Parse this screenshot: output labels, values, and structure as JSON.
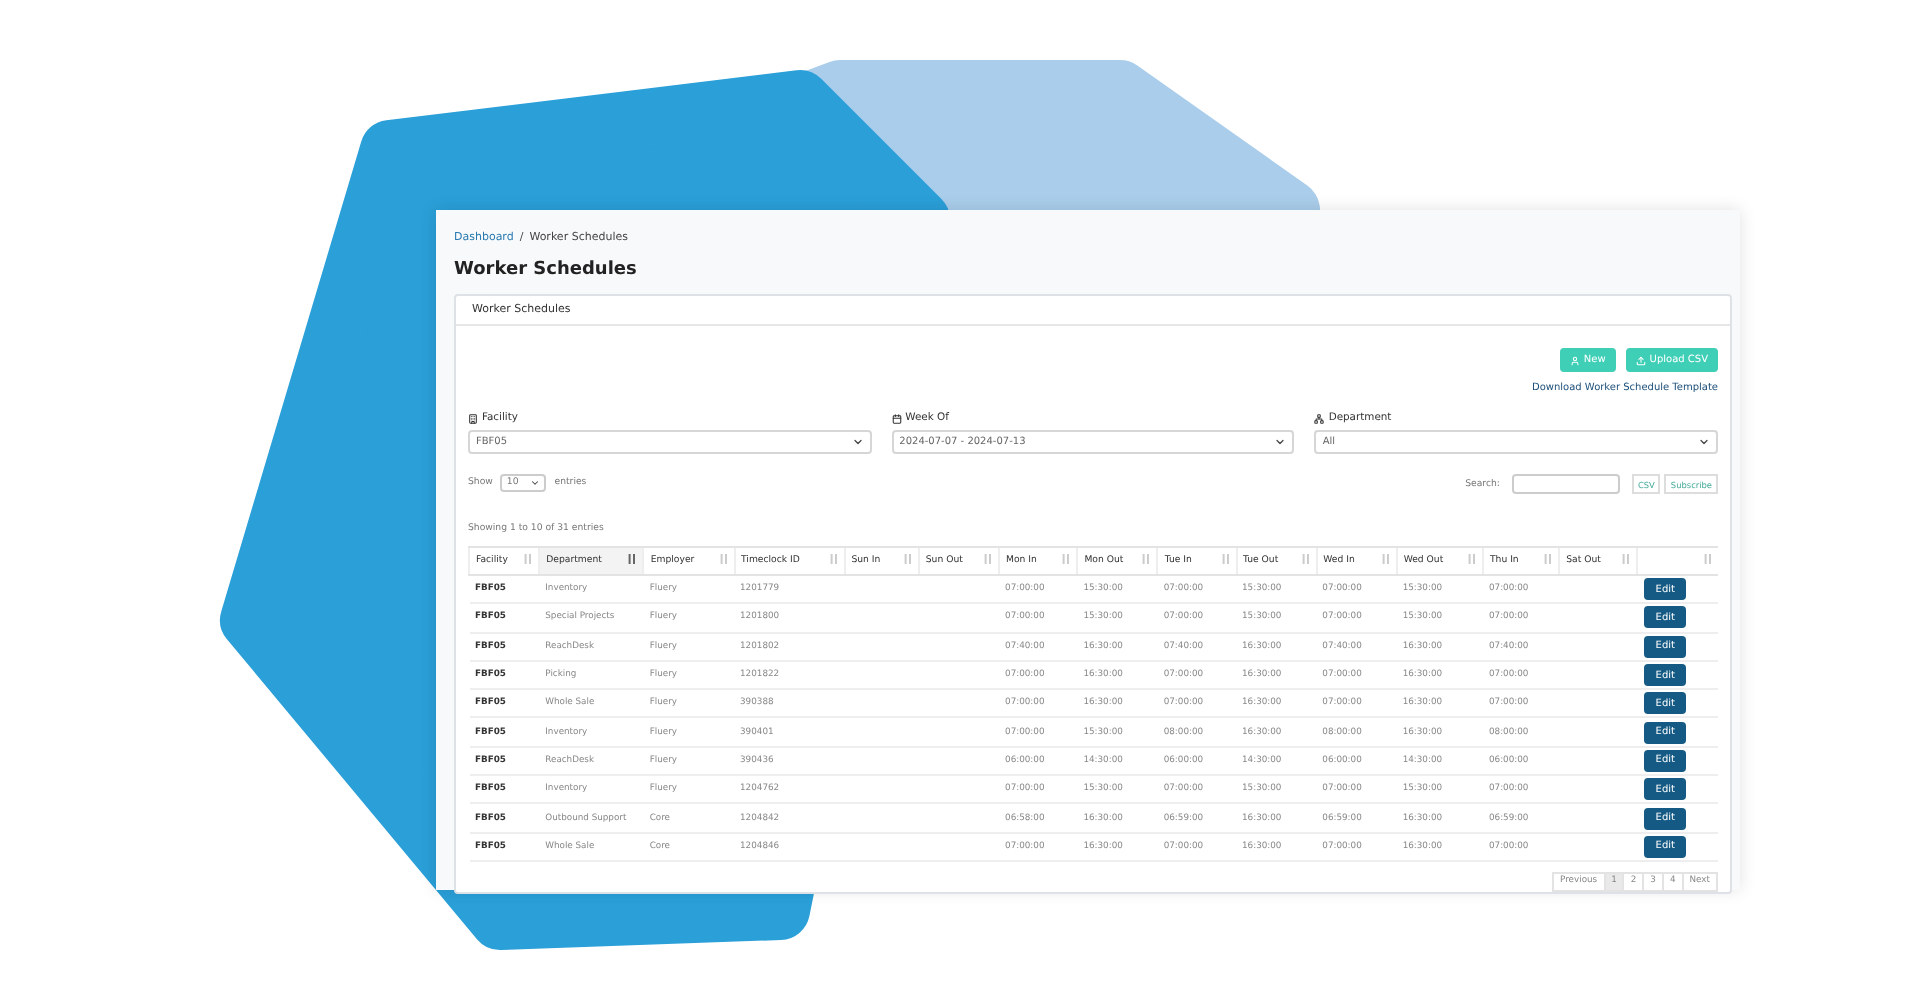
{
  "breadcrumb": [
    {
      "label": "Dashboard"
    },
    {
      "label": "Worker Schedules"
    }
  ],
  "breadcrumb_separator": "/",
  "page_title": "Worker Schedules",
  "card": {
    "title": "Worker Schedules",
    "buttons": [
      {
        "label": "New"
      },
      {
        "label": "Upload CSV"
      }
    ],
    "template_link": "Download Worker Schedule Template",
    "filters": [
      {
        "label": "Facility",
        "value": "FBF05"
      },
      {
        "label": "Week Of",
        "value": "2024-07-07 - 2024-07-13"
      },
      {
        "label": "Department",
        "value": "All"
      }
    ],
    "length": {
      "before": "Show",
      "value": "10",
      "after": "entries"
    },
    "info": "Showing 1 to 10 of 31 entries",
    "search_label": "Search:",
    "export_buttons": [
      "CSV",
      "Subscribe"
    ],
    "columns": [
      {
        "label": "Facility",
        "sorted": false
      },
      {
        "label": "Department",
        "sorted": true
      },
      {
        "label": "Employer",
        "sorted": false
      },
      {
        "label": "Timeclock ID",
        "sorted": false
      },
      {
        "label": "Sun In",
        "sorted": false
      },
      {
        "label": "Sun Out",
        "sorted": false
      },
      {
        "label": "Mon In",
        "sorted": false
      },
      {
        "label": "Mon Out",
        "sorted": false
      },
      {
        "label": "Tue In",
        "sorted": false
      },
      {
        "label": "Tue Out",
        "sorted": false
      },
      {
        "label": "Wed In",
        "sorted": false
      },
      {
        "label": "Wed Out",
        "sorted": false
      },
      {
        "label": "Thu In",
        "sorted": false
      },
      {
        "label": "Sat Out",
        "sorted": false
      },
      {
        "sorted": false
      }
    ],
    "rows": [
      {
        "cells": [
          "FBF05",
          "Inventory",
          "Fluery",
          "1201779",
          "",
          "",
          "07:00:00",
          "15:30:00",
          "07:00:00",
          "15:30:00",
          "07:00:00",
          "15:30:00",
          "07:00:00",
          ""
        ],
        "action": "Edit"
      },
      {
        "cells": [
          "FBF05",
          "Special Projects",
          "Fluery",
          "1201800",
          "",
          "",
          "07:00:00",
          "15:30:00",
          "07:00:00",
          "15:30:00",
          "07:00:00",
          "15:30:00",
          "07:00:00",
          ""
        ],
        "action": "Edit"
      },
      {
        "cells": [
          "FBF05",
          "ReachDesk",
          "Fluery",
          "1201802",
          "",
          "",
          "07:40:00",
          "16:30:00",
          "07:40:00",
          "16:30:00",
          "07:40:00",
          "16:30:00",
          "07:40:00",
          ""
        ],
        "action": "Edit"
      },
      {
        "cells": [
          "FBF05",
          "Picking",
          "Fluery",
          "1201822",
          "",
          "",
          "07:00:00",
          "16:30:00",
          "07:00:00",
          "16:30:00",
          "07:00:00",
          "16:30:00",
          "07:00:00",
          ""
        ],
        "action": "Edit"
      },
      {
        "cells": [
          "FBF05",
          "Whole Sale",
          "Fluery",
          "390388",
          "",
          "",
          "07:00:00",
          "16:30:00",
          "07:00:00",
          "16:30:00",
          "07:00:00",
          "16:30:00",
          "07:00:00",
          ""
        ],
        "action": "Edit"
      },
      {
        "cells": [
          "FBF05",
          "Inventory",
          "Fluery",
          "390401",
          "",
          "",
          "07:00:00",
          "15:30:00",
          "08:00:00",
          "16:30:00",
          "08:00:00",
          "16:30:00",
          "08:00:00",
          ""
        ],
        "action": "Edit"
      },
      {
        "cells": [
          "FBF05",
          "ReachDesk",
          "Fluery",
          "390436",
          "",
          "",
          "06:00:00",
          "14:30:00",
          "06:00:00",
          "14:30:00",
          "06:00:00",
          "14:30:00",
          "06:00:00",
          ""
        ],
        "action": "Edit"
      },
      {
        "cells": [
          "FBF05",
          "Inventory",
          "Fluery",
          "1204762",
          "",
          "",
          "07:00:00",
          "15:30:00",
          "07:00:00",
          "15:30:00",
          "07:00:00",
          "15:30:00",
          "07:00:00",
          ""
        ],
        "action": "Edit"
      },
      {
        "cells": [
          "FBF05",
          "Outbound Support",
          "Core",
          "1204842",
          "",
          "",
          "06:58:00",
          "16:30:00",
          "06:59:00",
          "16:30:00",
          "06:59:00",
          "16:30:00",
          "06:59:00",
          ""
        ],
        "action": "Edit"
      },
      {
        "cells": [
          "FBF05",
          "Whole Sale",
          "Core",
          "1204846",
          "",
          "",
          "07:00:00",
          "16:30:00",
          "07:00:00",
          "16:30:00",
          "07:00:00",
          "16:30:00",
          "07:00:00",
          ""
        ],
        "action": "Edit"
      }
    ],
    "pagination": [
      {
        "label": "Previous",
        "selected": false
      },
      {
        "label": "1",
        "selected": true
      },
      {
        "label": "2",
        "selected": false
      },
      {
        "label": "3",
        "selected": false
      },
      {
        "label": "4",
        "selected": false
      },
      {
        "label": "Next",
        "selected": false
      }
    ]
  }
}
